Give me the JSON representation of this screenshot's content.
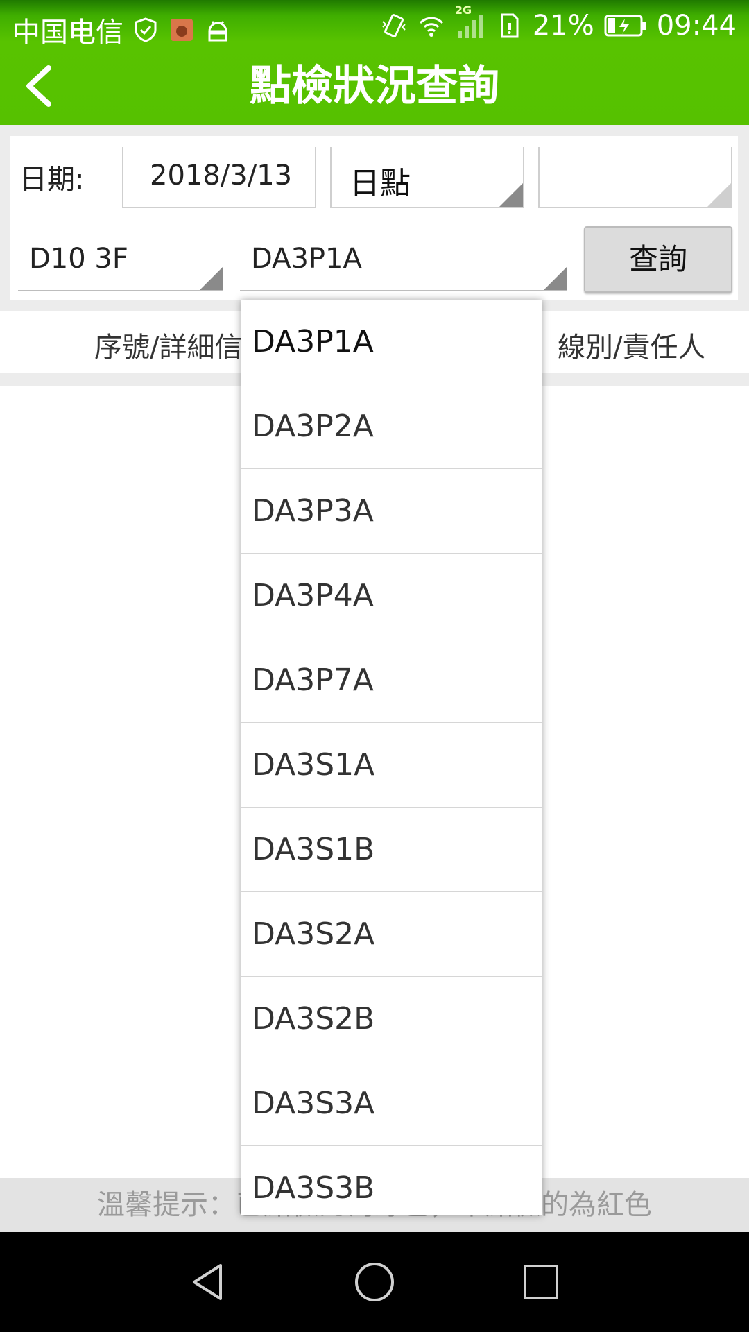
{
  "status_bar": {
    "carrier": "中国电信",
    "network": "2G",
    "battery": "21%",
    "time": "09:44",
    "icons": [
      "shield-check-icon",
      "app-notification-icon",
      "android-icon",
      "vibrate-icon",
      "wifi-icon",
      "signal-icon",
      "sim-icon",
      "battery-charging-icon"
    ]
  },
  "app_bar": {
    "title": "點檢狀況查詢",
    "back_icon": "back-arrow-icon"
  },
  "filters": {
    "date_label": "日期:",
    "date_value": "2018/3/13",
    "check_type": "日點",
    "extra_select": "",
    "area": "D10 3F",
    "line": "DA3P1A",
    "query_button": "查詢"
  },
  "table_header": {
    "col1": "序號/詳細信",
    "col2": "線別/責任人"
  },
  "tip": "溫馨提示：已點檢的為綠色，未點檢的為紅色",
  "dropdown": {
    "selected": "DA3P1A",
    "options": [
      "DA3P1A",
      "DA3P2A",
      "DA3P3A",
      "DA3P4A",
      "DA3P7A",
      "DA3S1A",
      "DA3S1B",
      "DA3S2A",
      "DA3S2B",
      "DA3S3A",
      "DA3S3B"
    ]
  },
  "nav_bar": {
    "icons": [
      "nav-back-icon",
      "nav-home-icon",
      "nav-recents-icon"
    ]
  }
}
